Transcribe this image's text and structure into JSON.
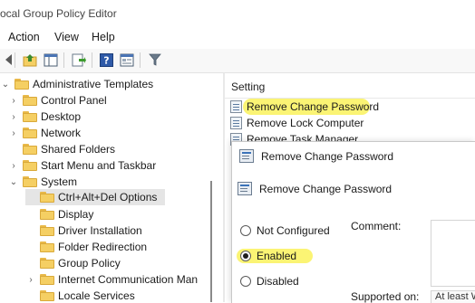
{
  "window": {
    "title": "ocal Group Policy Editor"
  },
  "menu": {
    "items": [
      "Action",
      "View",
      "Help"
    ]
  },
  "toolbar": {
    "icons": [
      "back-arrow-icon",
      "folder-up-icon",
      "show-hide-tree-icon",
      "export-list-icon",
      "help-icon",
      "properties-icon",
      "filter-icon"
    ]
  },
  "tree": {
    "items": [
      {
        "label": "Administrative Templates",
        "chevron": "down"
      },
      {
        "label": "Control Panel",
        "chevron": "right"
      },
      {
        "label": "Desktop",
        "chevron": "right"
      },
      {
        "label": "Network",
        "chevron": "right"
      },
      {
        "label": "Shared Folders",
        "chevron": ""
      },
      {
        "label": "Start Menu and Taskbar",
        "chevron": "right"
      },
      {
        "label": "System",
        "chevron": "down"
      },
      {
        "label": "Ctrl+Alt+Del Options",
        "chevron": "",
        "selected": true
      },
      {
        "label": "Display",
        "chevron": ""
      },
      {
        "label": "Driver Installation",
        "chevron": ""
      },
      {
        "label": "Folder Redirection",
        "chevron": ""
      },
      {
        "label": "Group Policy",
        "chevron": ""
      },
      {
        "label": "Internet Communication Man",
        "chevron": "right"
      },
      {
        "label": "Locale Services",
        "chevron": ""
      }
    ]
  },
  "list": {
    "header": "Setting",
    "rows": [
      "Remove Change Password",
      "Remove Lock Computer",
      "Remove Task Manager"
    ]
  },
  "dialog": {
    "title": "Remove Change Password",
    "policy_name": "Remove Change Password",
    "options": [
      {
        "label": "Not Configured",
        "checked": false
      },
      {
        "label": "Enabled",
        "checked": true
      },
      {
        "label": "Disabled",
        "checked": false
      }
    ],
    "comment_label": "Comment:",
    "supported_label": "Supported on:",
    "supported_value": "At least W"
  },
  "colors": {
    "highlight": "#faf046",
    "selection": "#e5e5e5",
    "folder": "#f5cf63"
  }
}
